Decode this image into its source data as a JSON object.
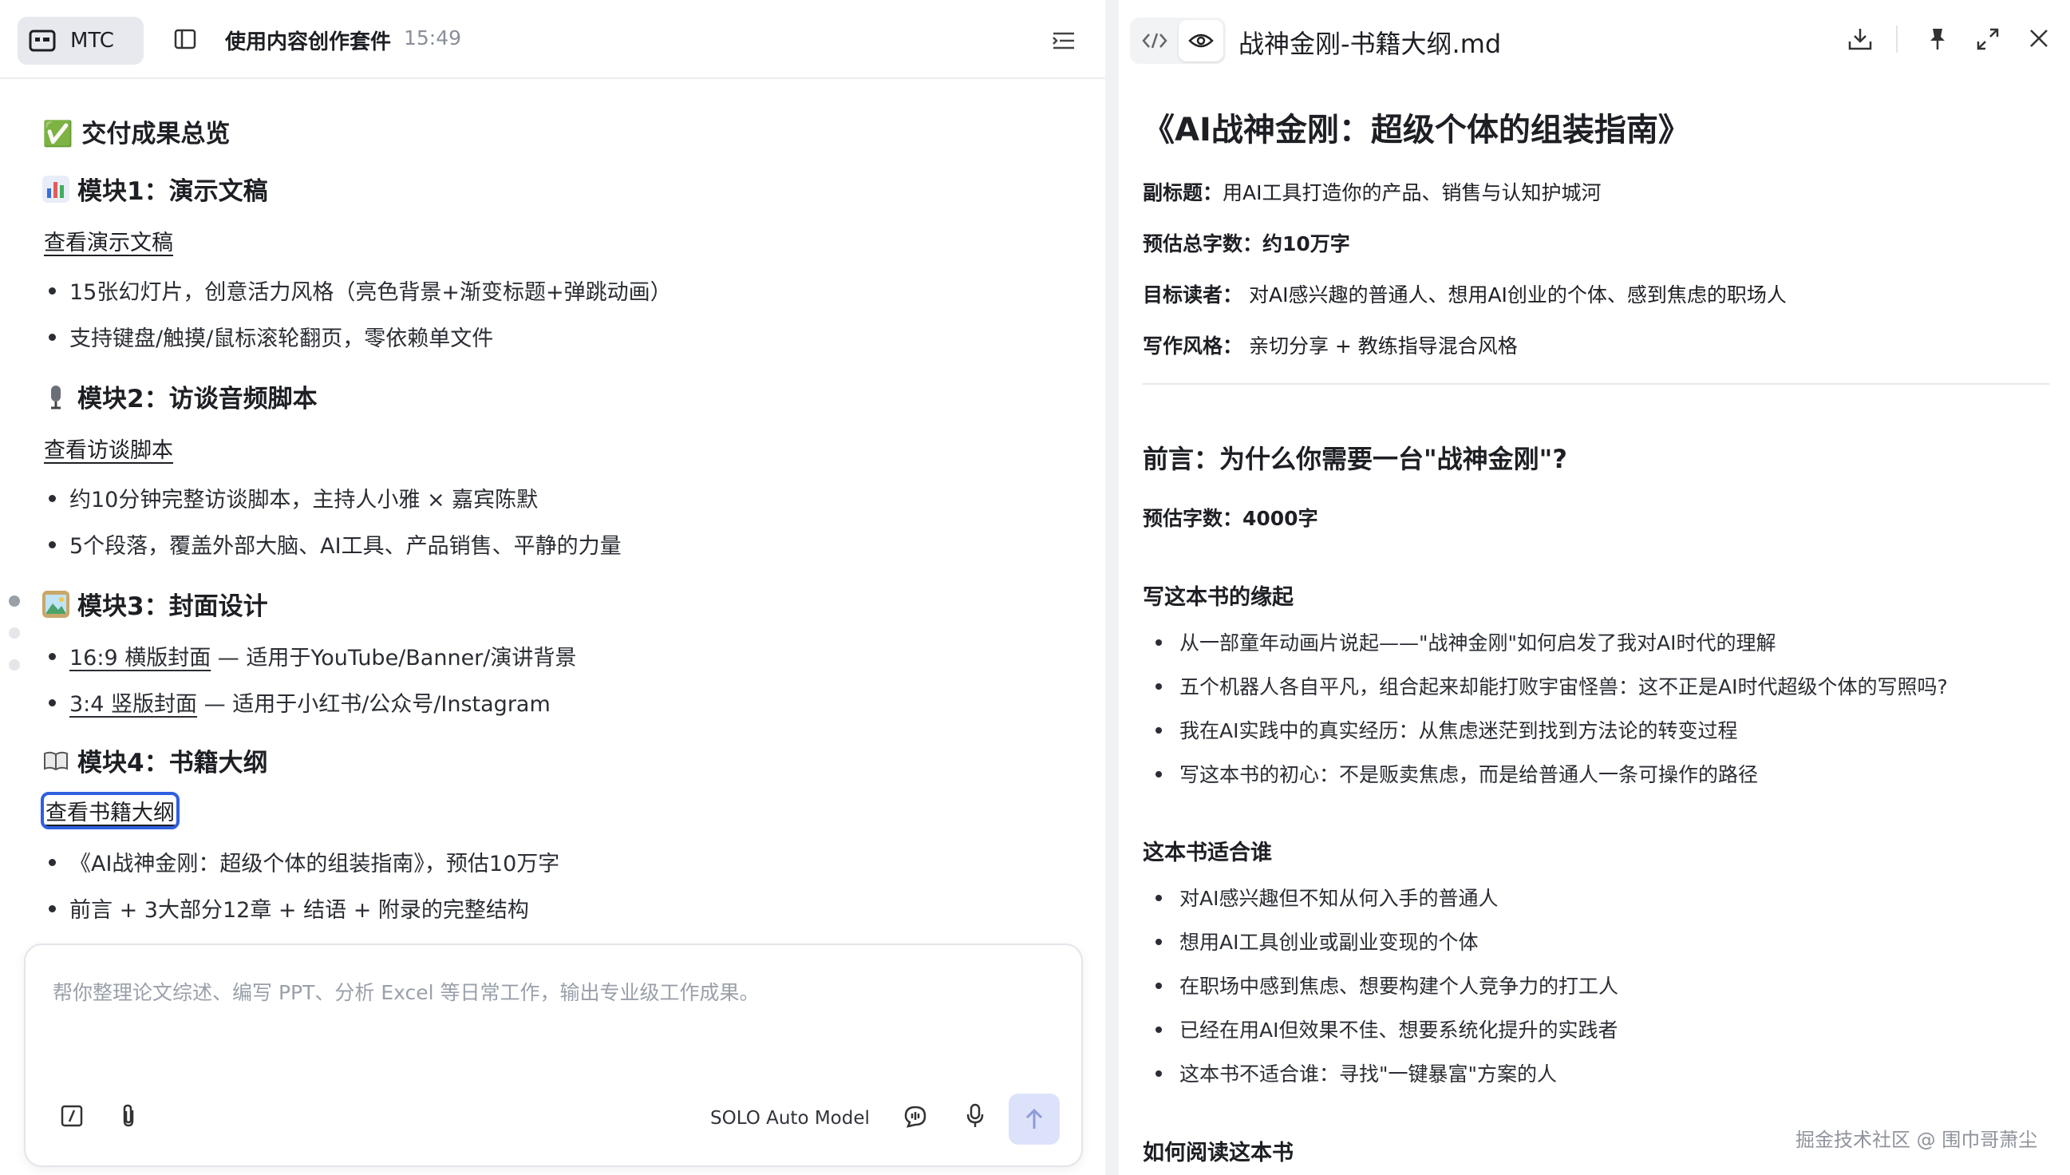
{
  "left": {
    "header": {
      "workspace_label": "MTC",
      "session_title": "使用内容创作套件",
      "session_time": "15:49"
    },
    "chat": {
      "summary_heading": "✅ 交付成果总览",
      "module1": {
        "heading": "模块1：演示文稿",
        "link": "查看演示文稿",
        "bullets": [
          "15张幻灯片，创意活力风格（亮色背景+渐变标题+弹跳动画）",
          "支持键盘/触摸/鼠标滚轮翻页，零依赖单文件"
        ]
      },
      "module2": {
        "heading": "模块2：访谈音频脚本",
        "link": "查看访谈脚本",
        "bullets": [
          "约10分钟完整访谈脚本，主持人小雅 × 嘉宾陈默",
          "5个段落，覆盖外部大脑、AI工具、产品销售、平静的力量"
        ]
      },
      "module3": {
        "heading": "模块3：封面设计",
        "items": [
          {
            "link": "16:9 横版封面",
            "text": " — 适用于YouTube/Banner/演讲背景"
          },
          {
            "link": "3:4 竖版封面",
            "text": " — 适用于小红书/公众号/Instagram"
          }
        ]
      },
      "module4": {
        "heading": "模块4：书籍大纲",
        "link": "查看书籍大纲",
        "bullets": [
          "《AI战神金刚：超级个体的组装指南》，预估10万字",
          "前言 + 3大部分12章 + 结语 + 附录的完整结构"
        ]
      }
    },
    "composer": {
      "placeholder": "帮你整理论文综述、编写 PPT、分析 Excel 等日常工作，输出专业级工作成果。",
      "model": "SOLO Auto Model"
    }
  },
  "right": {
    "header": {
      "file_name": "战神金刚-书籍大纲.md"
    },
    "doc": {
      "title": "《AI战神金刚：超级个体的组装指南》",
      "meta": [
        {
          "label": "副标题：",
          "value": "用AI工具打造你的产品、销售与认知护城河"
        },
        {
          "label": "预估总字数：",
          "value": "约10万字"
        },
        {
          "label": "目标读者：",
          "value": " 对AI感兴趣的普通人、想用AI创业的个体、感到焦虑的职场人"
        },
        {
          "label": "写作风格：",
          "value": " 亲切分享 + 教练指导混合风格"
        }
      ],
      "preface_heading": "前言：为什么你需要一台\"战神金刚\"?",
      "preface_words": "预估字数：4000字",
      "origin_heading": "写这本书的缘起",
      "origin_items": [
        "从一部童年动画片说起——\"战神金刚\"如何启发了我对AI时代的理解",
        "五个机器人各自平凡，组合起来却能打败宇宙怪兽：这不正是AI时代超级个体的写照吗?",
        "我在AI实践中的真实经历：从焦虑迷茫到找到方法论的转变过程",
        "写这本书的初心：不是贩卖焦虑，而是给普通人一条可操作的路径"
      ],
      "audience_heading": "这本书适合谁",
      "audience_items": [
        "对AI感兴趣但不知从何入手的普通人",
        "想用AI工具创业或副业变现的个体",
        "在职场中感到焦虑、想要构建个人竞争力的打工人",
        "已经在用AI但效果不佳、想要系统化提升的实践者",
        "这本书不适合谁：寻找\"一键暴富\"方案的人"
      ],
      "howto_heading": "如何阅读这本书"
    },
    "watermark": "掘金技术社区 @ 围巾哥萧尘"
  }
}
